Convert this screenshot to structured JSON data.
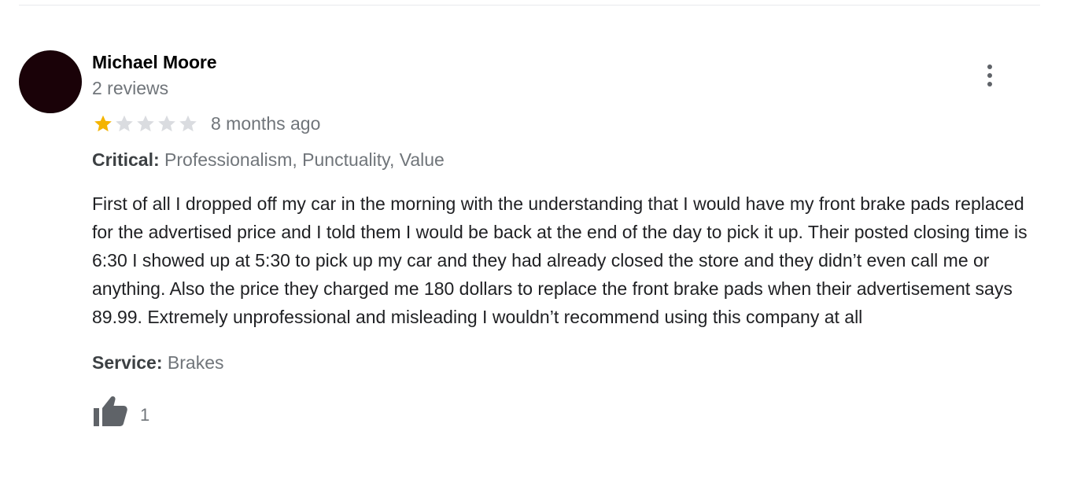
{
  "review": {
    "reviewer_name": "Michael Moore",
    "reviewer_meta": "2 reviews",
    "rating": 1,
    "rating_max": 5,
    "date": "8 months ago",
    "critical_label": "Critical:",
    "critical_value": "Professionalism, Punctuality, Value",
    "text": "First of all I dropped off my car in the morning with the understanding that I would have my front brake pads replaced for the advertised price and I told them I would be back at the end of the day to pick it up. Their posted closing time is 6:30 I showed up at 5:30 to pick up my car and they had already closed the store and they didn’t even call me or anything. Also the price they charged me 180 dollars to replace the front brake pads when their advertisement says 89.99. Extremely unprofessional and misleading I wouldn’t recommend using this company at all",
    "service_label": "Service:",
    "service_value": "Brakes",
    "like_count": "1"
  },
  "icons": {
    "more": "more-vert-icon",
    "like": "thumbs-up-icon",
    "star": "star-icon"
  },
  "colors": {
    "star_filled": "#f4b400",
    "star_empty": "#dadce0",
    "avatar": "#1a0208",
    "muted_text": "#70757a",
    "icon_gray": "#5f6368"
  }
}
